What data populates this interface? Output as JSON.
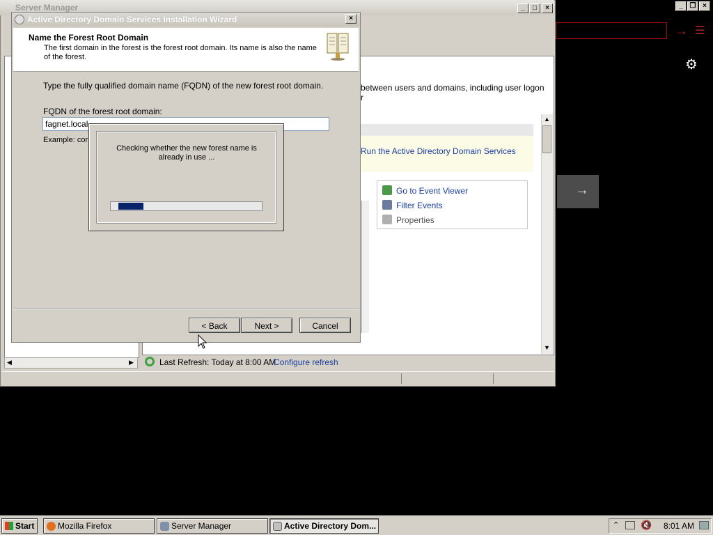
{
  "server_manager": {
    "title": "Server Manager",
    "description_line1": "between users and domains, including user logon",
    "description_line2": "r",
    "banner_link": "Run the Active Directory Domain Services",
    "actions": [
      "Go to Event Viewer",
      "Filter Events",
      "Properties"
    ],
    "last_refresh": "Last Refresh: Today at 8:00 AM",
    "configure_refresh": "Configure refresh"
  },
  "wizard": {
    "title": "Active Directory Domain Services Installation Wizard",
    "heading": "Name the Forest Root Domain",
    "subtext": "The first domain in the forest is the forest root domain. Its name is also the name of the forest.",
    "instruction": "Type the fully qualified domain name (FQDN) of the new forest root domain.",
    "fqdn_label": "FQDN of the forest root domain:",
    "fqdn_value": "fagnet.local",
    "example": "Example: corp",
    "buttons": {
      "back": "< Back",
      "next": "Next >",
      "cancel": "Cancel"
    }
  },
  "progress_dialog": {
    "message": "Checking whether the new forest name is already in use ...",
    "progress_fraction": 0.17
  },
  "taskbar": {
    "start": "Start",
    "tasks": [
      {
        "label": "Mozilla Firefox",
        "active": false
      },
      {
        "label": "Server Manager",
        "active": false
      },
      {
        "label": "Active Directory Dom...",
        "active": true
      }
    ],
    "clock": "8:01 AM"
  },
  "icons": {
    "window_minimize": "minimize-icon",
    "window_maximize": "maximize-icon",
    "window_close": "close-icon",
    "settings": "gear-icon",
    "next_arrow": "arrow-right-icon",
    "menu": "hamburger-menu-icon"
  },
  "colors": {
    "progress_fill": "#0a246a",
    "link": "#1a3fa0",
    "dialog_face": "#d4d0c8"
  }
}
